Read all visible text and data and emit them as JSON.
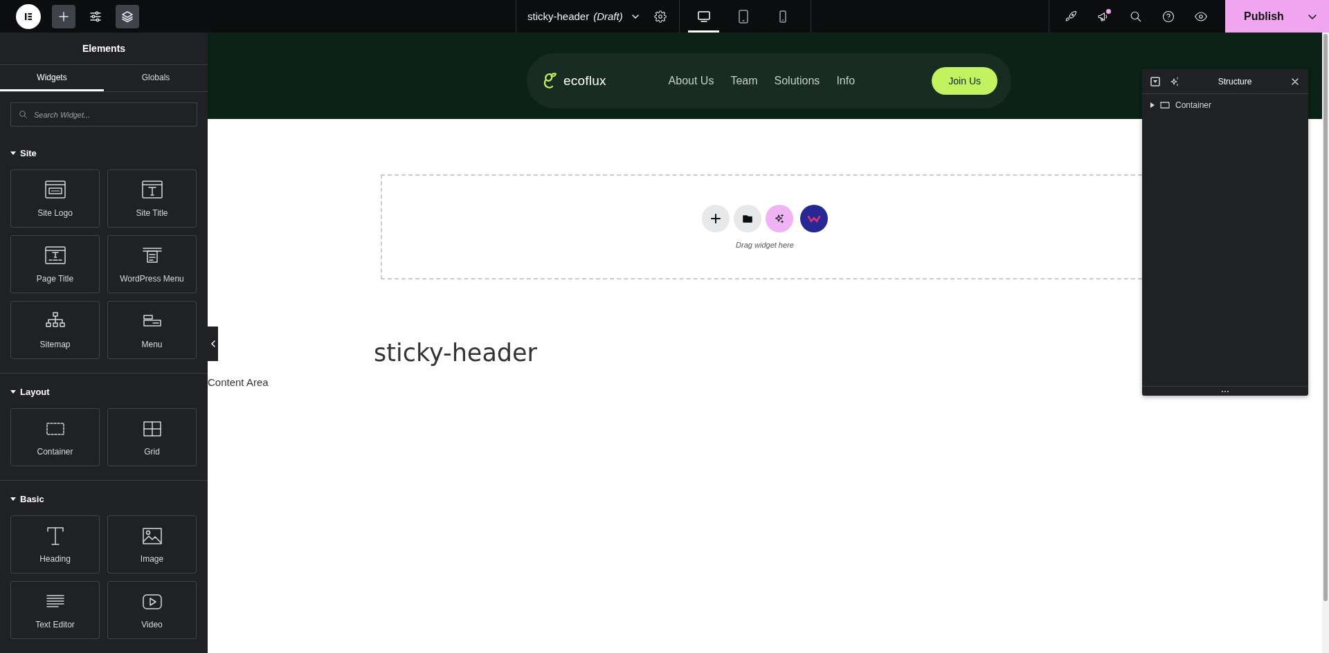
{
  "topbar": {
    "document": {
      "title": "sticky-header",
      "status": "(Draft)"
    },
    "devices": [
      {
        "kind": "desktop",
        "selected": true
      },
      {
        "kind": "tablet",
        "selected": false
      },
      {
        "kind": "mobile",
        "selected": false
      }
    ],
    "notification": true,
    "publish": "Publish"
  },
  "sidebar": {
    "title": "Elements",
    "tabs": [
      {
        "label": "Widgets",
        "selected": true
      },
      {
        "label": "Globals",
        "selected": false
      }
    ],
    "search": {
      "placeholder": "Search Widget..."
    },
    "categories": [
      {
        "name": "Site",
        "expanded": true,
        "widgets": [
          {
            "label": "Site Logo",
            "kind": "site-logo"
          },
          {
            "label": "Site Title",
            "kind": "site-title"
          },
          {
            "label": "Page Title",
            "kind": "page-title"
          },
          {
            "label": "WordPress Menu",
            "kind": "nav-menu"
          },
          {
            "label": "Sitemap",
            "kind": "sitemap"
          },
          {
            "label": "Menu",
            "kind": "menu"
          }
        ]
      },
      {
        "name": "Layout",
        "expanded": true,
        "widgets": [
          {
            "label": "Container",
            "kind": "container"
          },
          {
            "label": "Grid",
            "kind": "grid"
          }
        ]
      },
      {
        "name": "Basic",
        "expanded": true,
        "widgets": [
          {
            "label": "Heading",
            "kind": "heading"
          },
          {
            "label": "Image",
            "kind": "image"
          },
          {
            "label": "Text Editor",
            "kind": "text-editor"
          },
          {
            "label": "Video",
            "kind": "video"
          }
        ]
      }
    ]
  },
  "site_header": {
    "logo": "ecoflux",
    "nav": [
      "About Us",
      "Team",
      "Solutions",
      "Info"
    ],
    "cta": "Join Us"
  },
  "dropzone": {
    "hint": "Drag widget here"
  },
  "page": {
    "heading": "sticky-header",
    "content": "Content Area"
  },
  "structure": {
    "title": "Structure",
    "items": [
      {
        "label": "Container",
        "expanded": false
      }
    ]
  }
}
